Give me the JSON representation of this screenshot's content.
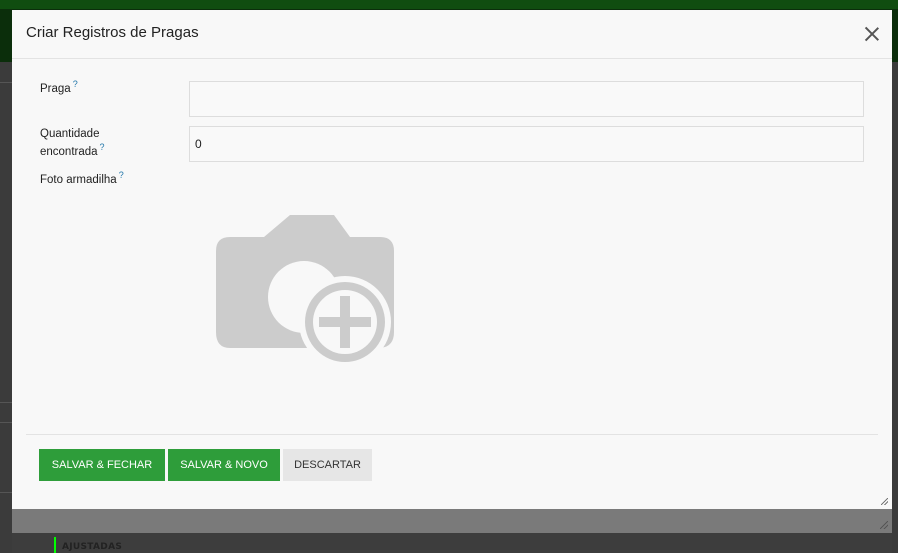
{
  "dialog": {
    "title": "Criar Registros de Pragas",
    "close_icon": "close-icon"
  },
  "form": {
    "praga": {
      "label": "Praga",
      "help": "?",
      "value": ""
    },
    "quantidade": {
      "label_line1": "Quantidade",
      "label_line2": "encontrada",
      "help": "?",
      "value": "0"
    },
    "foto": {
      "label": "Foto armadilha",
      "help": "?",
      "icon": "camera-add-icon"
    }
  },
  "buttons": {
    "save_close": "SALVAR & FECHAR",
    "save_new": "SALVAR & NOVO",
    "discard": "DESCARTAR"
  },
  "background": {
    "status_label": "AJUSTADAS"
  },
  "colors": {
    "primary": "#2e9d3a",
    "help": "#2277aa",
    "icon_gray": "#cccccc"
  }
}
